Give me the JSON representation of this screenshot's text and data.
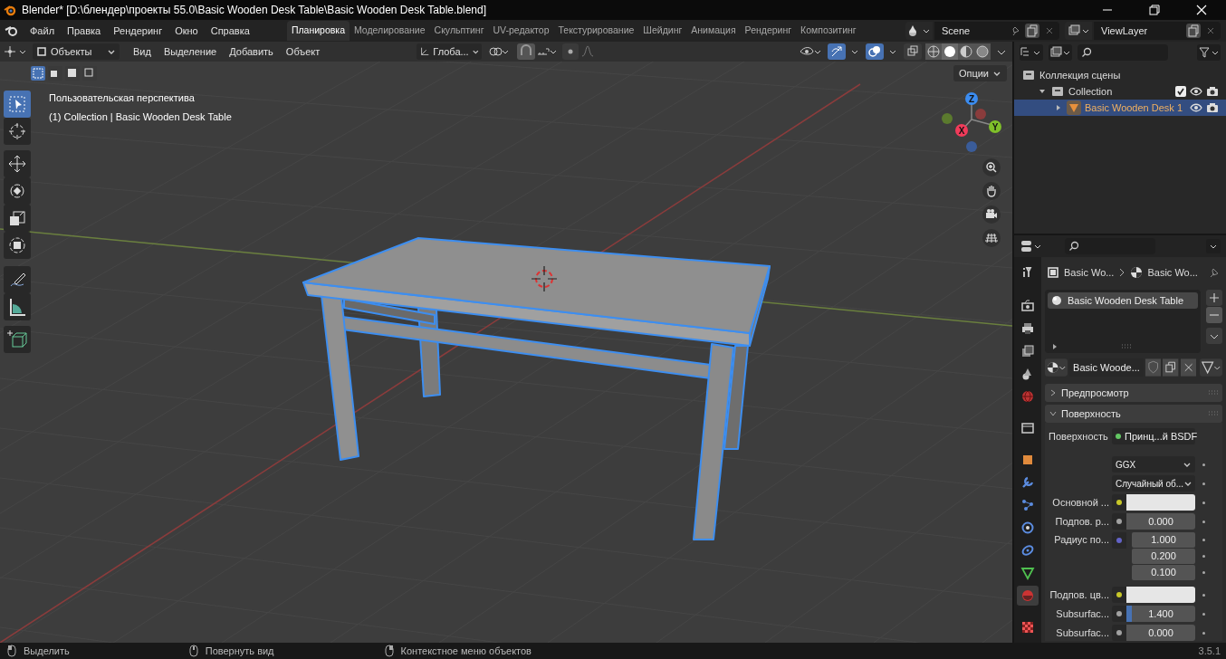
{
  "title_bar": {
    "title": "Blender* [D:\\блендер\\проекты 55.0\\Basic Wooden Desk Table\\Basic Wooden Desk Table.blend]"
  },
  "menu": [
    "Файл",
    "Правка",
    "Рендеринг",
    "Окно",
    "Справка"
  ],
  "workspaces": [
    {
      "label": "Планировка",
      "selected": true
    },
    {
      "label": "Моделирование",
      "selected": false
    },
    {
      "label": "Скульптинг",
      "selected": false
    },
    {
      "label": "UV-редактор",
      "selected": false
    },
    {
      "label": "Текстурирование",
      "selected": false
    },
    {
      "label": "Шейдинг",
      "selected": false
    },
    {
      "label": "Анимация",
      "selected": false
    },
    {
      "label": "Рендеринг",
      "selected": false
    },
    {
      "label": "Композитинг",
      "selected": false
    }
  ],
  "scene": "Scene",
  "view_layer": "ViewLayer",
  "viewport": {
    "mode": "Объекты",
    "menus": [
      "Вид",
      "Выделение",
      "Добавить",
      "Объект"
    ],
    "orientation": "Глоба...",
    "options": "Опции",
    "overlay_lines": [
      "Пользовательская перспектива",
      "(1) Collection | Basic Wooden Desk Table"
    ],
    "tools": [
      {
        "kind": "select",
        "selected": true
      },
      {
        "kind": "cursor",
        "selected": false
      },
      {
        "kind": "move",
        "selected": false
      },
      {
        "kind": "rotate",
        "selected": false
      },
      {
        "kind": "scale",
        "selected": false
      },
      {
        "kind": "transform",
        "selected": false
      },
      {
        "kind": "annotate",
        "selected": false
      },
      {
        "kind": "measure",
        "selected": false
      },
      {
        "kind": "add_cube",
        "selected": false
      }
    ],
    "gizmo": {
      "x": "X",
      "y": "Y",
      "z": "Z"
    }
  },
  "outliner": {
    "items": [
      {
        "label": "Коллекция сцены",
        "selected": false,
        "children": [
          {
            "label": "Collection",
            "expanded": true,
            "checked": true,
            "selected": false,
            "children": [
              {
                "label": "Basic Wooden Desk 1",
                "expanded": false,
                "selected": true
              }
            ]
          }
        ]
      }
    ]
  },
  "properties": {
    "tabs": [
      {
        "kind": "tool",
        "selected": false
      },
      {
        "kind": "render",
        "selected": false
      },
      {
        "kind": "output",
        "selected": false
      },
      {
        "kind": "view_layer",
        "selected": false
      },
      {
        "kind": "scene",
        "selected": false
      },
      {
        "kind": "world",
        "selected": false
      },
      {
        "kind": "collection",
        "selected": false
      },
      {
        "kind": "object",
        "selected": false
      },
      {
        "kind": "modifiers",
        "selected": false
      },
      {
        "kind": "particles",
        "selected": false
      },
      {
        "kind": "physics",
        "selected": false
      },
      {
        "kind": "constraints",
        "selected": false
      },
      {
        "kind": "data",
        "selected": false
      },
      {
        "kind": "material",
        "selected": true
      },
      {
        "kind": "texture",
        "selected": false
      }
    ],
    "breadcrumb": [
      "Basic Wo...",
      "Basic Wo..."
    ],
    "material_slots": [
      {
        "name": "Basic Wooden Desk Table",
        "selected": true
      }
    ],
    "material_name": "Basic Woode...",
    "panels": [
      {
        "label": "Предпросмотр",
        "expanded": false
      },
      {
        "label": "Поверхность",
        "expanded": true
      }
    ],
    "fields": [
      {
        "kind": "link",
        "label": "Поверхность",
        "value": "Принц...й BSDF",
        "color": "#63c763"
      },
      {
        "kind": "dropdown",
        "value": "GGX"
      },
      {
        "kind": "dropdown",
        "value": "Случайный об..."
      },
      {
        "kind": "color",
        "label": "Основной ...",
        "color": "#c7c729"
      },
      {
        "kind": "number",
        "label": "Подпов. р...",
        "color": "#a1a1a1",
        "value": "0.000"
      },
      {
        "kind": "vector",
        "label": "Радиус по...",
        "color": "#6363c7",
        "values": [
          "1.000",
          "0.200",
          "0.100"
        ]
      },
      {
        "kind": "color",
        "label": "Подпов. цв...",
        "color": "#c7c729"
      },
      {
        "kind": "slider",
        "label": "Subsurfac...",
        "color": "#a1a1a1",
        "value": "1.400",
        "level": 0.08
      },
      {
        "kind": "number",
        "label": "Subsurfac...",
        "color": "#a1a1a1",
        "value": "0.000"
      }
    ]
  },
  "status_bar": {
    "items": [
      "Выделить",
      "Повернуть вид",
      "Контекстное меню объектов"
    ],
    "version": "3.5.1"
  }
}
